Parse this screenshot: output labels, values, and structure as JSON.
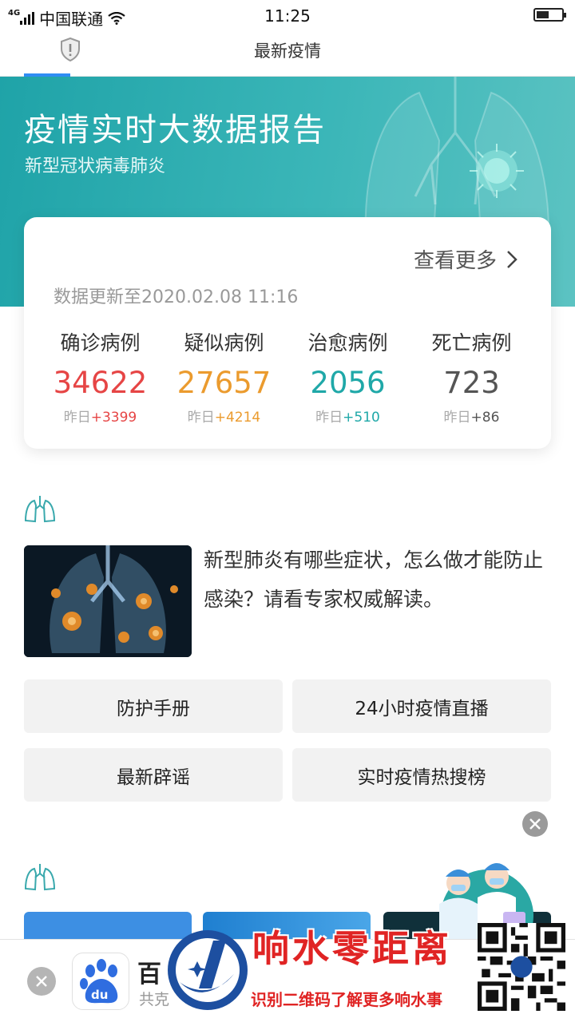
{
  "status_bar": {
    "network": "4G",
    "carrier": "中国联通",
    "time": "11:25",
    "battery_level": 0.5
  },
  "nav": {
    "title": "最新疫情"
  },
  "banner": {
    "title": "疫情实时大数据报告",
    "subtitle": "新型冠状病毒肺炎"
  },
  "summary": {
    "more_label": "查看更多",
    "update_text": "数据更新至2020.02.08 11:16",
    "stats": [
      {
        "label": "确诊病例",
        "value": "34622",
        "delta_prefix": "昨日",
        "delta": "+3399",
        "color": "#e64545",
        "delta_color": "#e64545"
      },
      {
        "label": "疑似病例",
        "value": "27657",
        "delta_prefix": "昨日",
        "delta": "+4214",
        "color": "#eb9b2e",
        "delta_color": "#eb9b2e"
      },
      {
        "label": "治愈病例",
        "value": "2056",
        "delta_prefix": "昨日",
        "delta": "+510",
        "color": "#1fa8a8",
        "delta_color": "#1fa8a8"
      },
      {
        "label": "死亡病例",
        "value": "723",
        "delta_prefix": "昨日",
        "delta": "+86",
        "color": "#555555",
        "delta_color": "#555555"
      }
    ]
  },
  "article": {
    "text": "新型肺炎有哪些症状，怎么做才能防止感染？请看专家权威解读。"
  },
  "buttons": [
    {
      "label": "防护手册"
    },
    {
      "label": "24小时疫情直播"
    },
    {
      "label": "最新辟谣"
    },
    {
      "label": "实时疫情热搜榜"
    }
  ],
  "bottom_bar": {
    "app_name": "百",
    "app_desc": "共克"
  },
  "watermark": {
    "title": "响水零距离",
    "subtitle": "识别二维码了解更多响水事"
  }
}
